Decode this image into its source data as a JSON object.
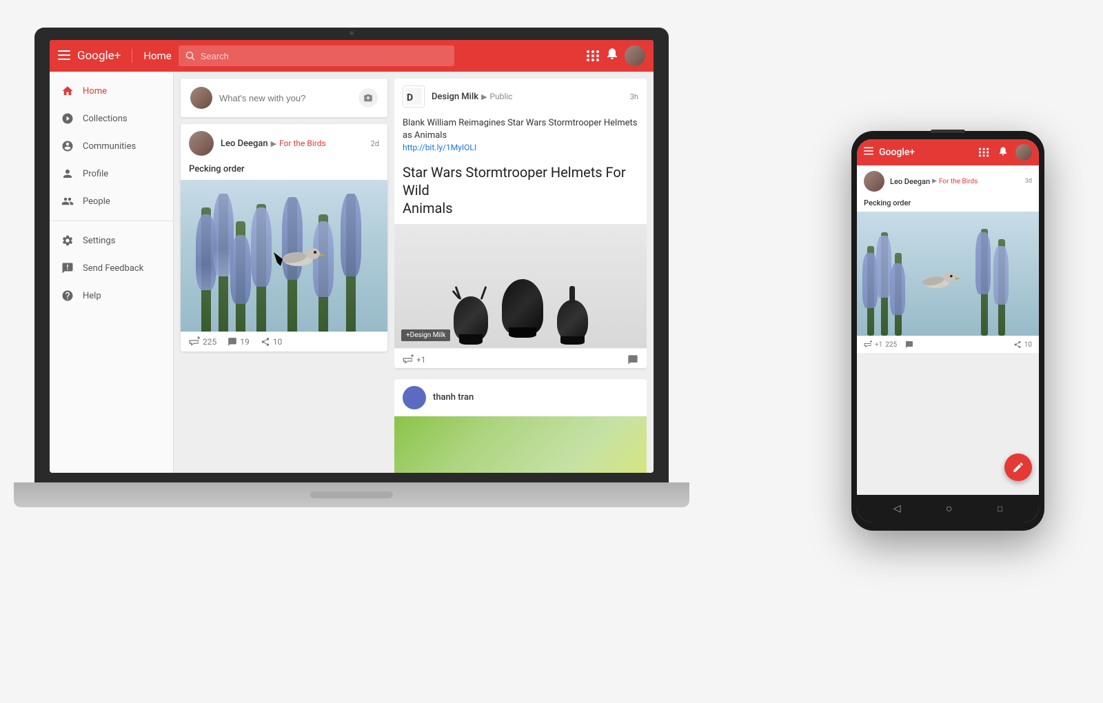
{
  "scene": {
    "background": "#f0f0f0"
  },
  "desktop_header": {
    "menu_icon": "☰",
    "logo": "Google+",
    "nav_title": "Home",
    "search_placeholder": "Search",
    "grid_icon": "⊞",
    "bell_icon": "🔔",
    "user_avatar_bg": "#8d6e63"
  },
  "sidebar": {
    "items": [
      {
        "id": "home",
        "label": "Home",
        "active": true
      },
      {
        "id": "collections",
        "label": "Collections",
        "active": false
      },
      {
        "id": "communities",
        "label": "Communities",
        "active": false
      },
      {
        "id": "profile",
        "label": "Profile",
        "active": false
      },
      {
        "id": "people",
        "label": "People",
        "active": false
      }
    ],
    "secondary_items": [
      {
        "id": "settings",
        "label": "Settings"
      },
      {
        "id": "feedback",
        "label": "Send Feedback"
      },
      {
        "id": "help",
        "label": "Help"
      }
    ]
  },
  "whats_new": {
    "placeholder": "What's new with you?"
  },
  "post1": {
    "author": "Leo Deegan",
    "collection": "For the Birds",
    "time": "2d",
    "title": "Pecking order",
    "plus_count": "225",
    "comment_count": "19",
    "share_count": "10",
    "avatar_bg": "#8d6e63"
  },
  "post2": {
    "source": "Design Milk",
    "visibility": "Public",
    "time": "3h",
    "description": "Blank William Reimagines Star Wars Stormtrooper Helmets as Animals",
    "link": "http://bit.ly/1MyIOLI",
    "headline_line1": "Star Wars Stormtrooper Helmets For Wild",
    "headline_line2": "Animals",
    "badge": "+Design Milk",
    "plus_count": "+1",
    "avatar_bg": "#8d6e63"
  },
  "post3": {
    "author": "thanh tran",
    "avatar_bg": "#5c6bc0"
  },
  "phone": {
    "logo": "Google+",
    "post": {
      "author": "Leo Deegan",
      "collection": "For the Birds",
      "time": "3d",
      "title": "Pecking order",
      "plus_count": "225",
      "comment_count": "",
      "share_count": "10"
    },
    "nav": {
      "back": "◁",
      "home": "○",
      "recent": "□"
    }
  }
}
